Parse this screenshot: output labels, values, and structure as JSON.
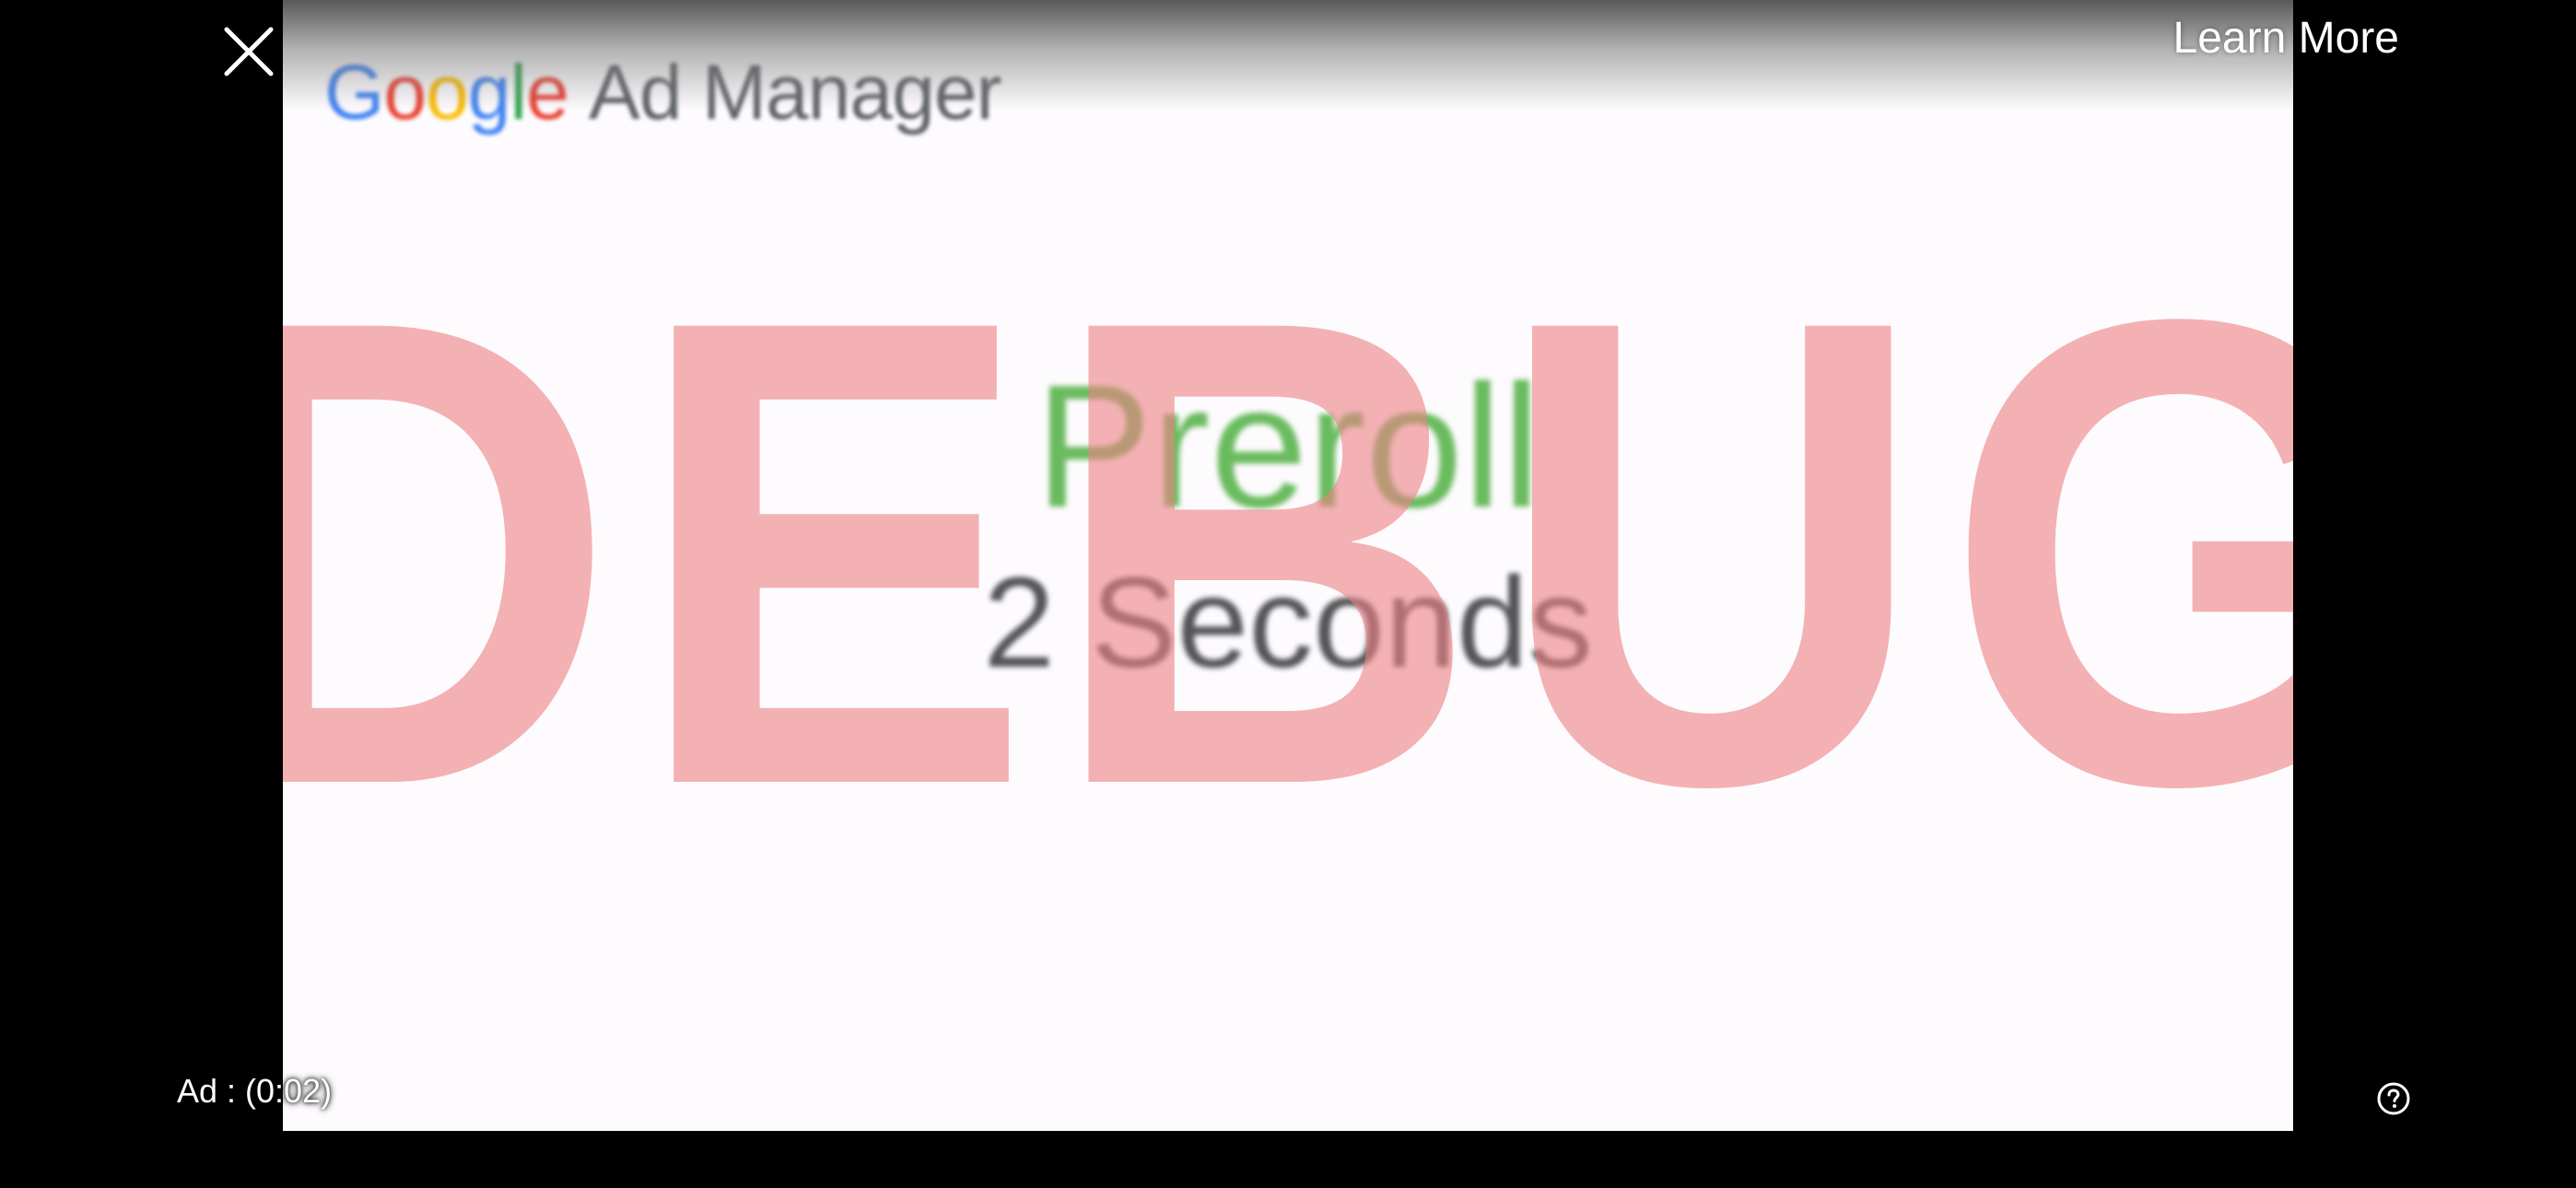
{
  "ad_player": {
    "learn_more_label": "Learn More",
    "ad_countdown": "Ad : (0:02)",
    "close_icon": "close-icon",
    "help_icon": "question-circle-icon"
  },
  "creative": {
    "logo_g": "G",
    "logo_o1": "o",
    "logo_o2": "o",
    "logo_g2": "g",
    "logo_l": "l",
    "logo_e": "e",
    "logo_rest": "Ad Manager",
    "title": "Preroll",
    "subtitle": "2 Seconds"
  },
  "debug_overlay": {
    "label": "DEBUG",
    "color": "#ec8084"
  },
  "colors": {
    "background": "#000000",
    "frame": "#fdfbfd",
    "title_green": "#6abb5f",
    "subtitle_gray": "#555558"
  }
}
